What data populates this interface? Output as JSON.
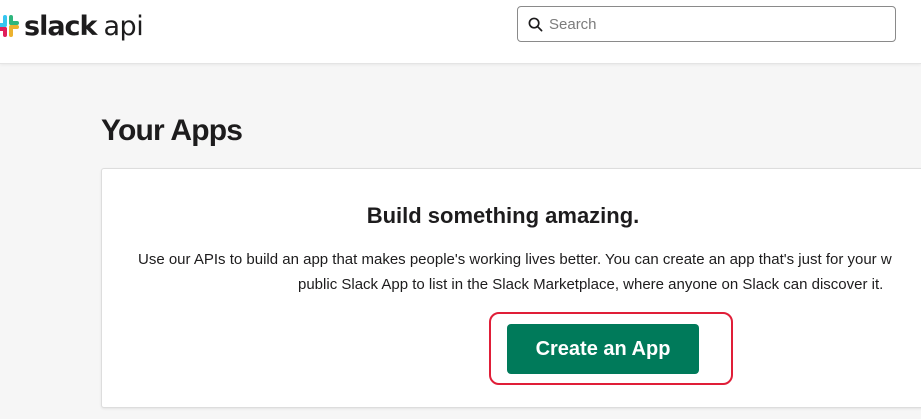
{
  "header": {
    "logo_word": "slack",
    "logo_suffix": "api",
    "search": {
      "placeholder": "Search",
      "value": ""
    }
  },
  "main": {
    "title": "Your Apps",
    "card": {
      "heading": "Build something amazing.",
      "body_line1": "Use our APIs to build an app that makes people's working lives better. You can create an app that's just for your w",
      "body_line2": "public Slack App to list in the Slack Marketplace, where anyone on Slack can discover it.",
      "button_label": "Create an App"
    }
  },
  "colors": {
    "brand_green": "#007a5a",
    "highlight_red": "#e01e38",
    "logo_blue": "#36c5f0",
    "logo_green": "#2eb67d",
    "logo_yellow": "#ecb22e",
    "logo_red": "#e01e5a"
  },
  "icons": [
    "slack-logo-icon",
    "search-icon"
  ]
}
